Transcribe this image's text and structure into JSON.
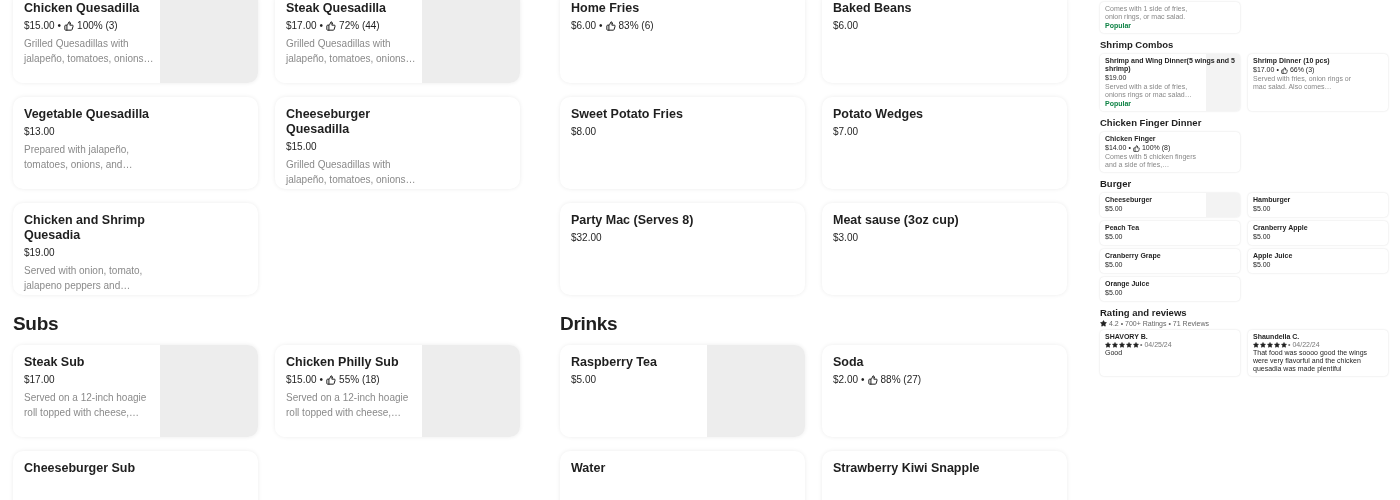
{
  "separator": "•",
  "columns": [
    {
      "sections": [
        {
          "items": [
            {
              "title": "Chicken Quesadilla",
              "price": "$15.00",
              "rating": "100% (3)",
              "description": "Grilled Quesadillas with jalapeño, tomatoes, onions…",
              "image": true
            },
            {
              "title": "Steak Quesadilla",
              "price": "$17.00",
              "rating": "72% (44)",
              "description": "Grilled Quesadillas with jalapeño, tomatoes, onions…",
              "image": true
            },
            {
              "title": "Vegetable Quesadilla",
              "price": "$13.00",
              "description": "Prepared with jalapeño, tomatoes, onions, and…",
              "image": false
            },
            {
              "title": "Cheeseburger Quesadilla",
              "price": "$15.00",
              "description": "Grilled Quesadillas with jalapeño, tomatoes, onions…",
              "image": false
            },
            {
              "title": "Chicken and Shrimp Quesadia",
              "price": "$19.00",
              "description": "Served with onion, tomato, jalapeno peppers and…",
              "image": false
            }
          ]
        },
        {
          "heading": "Subs",
          "items": [
            {
              "title": "Steak Sub",
              "price": "$17.00",
              "description": "Served on a 12-inch hoagie roll topped with cheese,…",
              "image": true
            },
            {
              "title": "Chicken Philly Sub",
              "price": "$15.00",
              "rating": "55% (18)",
              "description": "Served on a 12-inch hoagie roll topped with cheese,…",
              "image": true
            },
            {
              "title": "Cheeseburger Sub",
              "image": false
            }
          ]
        }
      ]
    },
    {
      "sections": [
        {
          "items": [
            {
              "title": "Home Fries",
              "price": "$6.00",
              "rating": "83% (6)",
              "image": false
            },
            {
              "title": "Baked Beans",
              "price": "$6.00",
              "image": false
            },
            {
              "title": "Sweet Potato Fries",
              "price": "$8.00",
              "image": false
            },
            {
              "title": "Potato Wedges",
              "price": "$7.00",
              "image": false
            },
            {
              "title": "Party Mac  (Serves 8)",
              "price": "$32.00",
              "image": false
            },
            {
              "title": "Meat sause (3oz cup)",
              "price": "$3.00",
              "image": false
            }
          ]
        },
        {
          "heading": "Drinks",
          "items": [
            {
              "title": "Raspberry Tea",
              "price": "$5.00",
              "image": true
            },
            {
              "title": "Soda",
              "price": "$2.00",
              "rating": "88% (27)",
              "image": false
            },
            {
              "title": "Water",
              "image": false
            },
            {
              "title": "Strawberry Kiwi Snapple",
              "image": false
            }
          ]
        }
      ]
    }
  ],
  "preview": {
    "sections": [
      {
        "items": [
          {
            "description": "Comes with 1 side of fries, onion rings, or mac salad.",
            "badge": "Popular",
            "image": false
          }
        ]
      },
      {
        "heading": "Shrimp Combos",
        "items": [
          {
            "title": "Shrimp and Wing Dinner(5 wings and 5 shrimp)",
            "price": "$19.00",
            "description": "Served with a side of fries, onions rings or mac salad…",
            "badge": "Popular",
            "image": true
          },
          {
            "title": "Shrimp Dinner (10 pcs)",
            "price": "$17.00",
            "rating": "66% (3)",
            "description": "Served with fries, onion rings or mac salad. Also comes…",
            "image": false
          }
        ]
      },
      {
        "heading": "Chicken Finger Dinner",
        "items": [
          {
            "title": "Chicken Finger",
            "price": "$14.00",
            "rating": "100% (8)",
            "description": "Comes with 5 chicken fingers and a side of fries,…",
            "image": false
          }
        ]
      },
      {
        "heading": "Burger",
        "items": [
          {
            "title": "Cheeseburger",
            "price": "$5.00",
            "image": true
          },
          {
            "title": "Hamburger",
            "price": "$5.00",
            "image": false
          },
          {
            "title": "Peach Tea",
            "price": "$5.00",
            "image": false
          },
          {
            "title": "Cranberry Apple",
            "price": "$5.00",
            "image": false
          },
          {
            "title": "Cranberry Grape",
            "price": "$5.00",
            "image": false
          },
          {
            "title": "Apple Juice",
            "price": "$5.00",
            "image": false
          },
          {
            "title": "Orange Juice",
            "price": "$5.00",
            "image": false
          }
        ]
      }
    ],
    "reviews": {
      "heading": "Rating and reviews",
      "summary": "4.2 • 700+ Ratings • 71 Reviews",
      "items": [
        {
          "author": "SHAVORY B.",
          "stars": 5,
          "date": "• 04/25/24",
          "text": "Good"
        },
        {
          "author": "Shaundella C.",
          "stars": 5,
          "date": "• 04/22/24",
          "text": "That food was soooo good the wings were very flavorful and the chicken quesadia was made plentiful"
        }
      ]
    }
  }
}
